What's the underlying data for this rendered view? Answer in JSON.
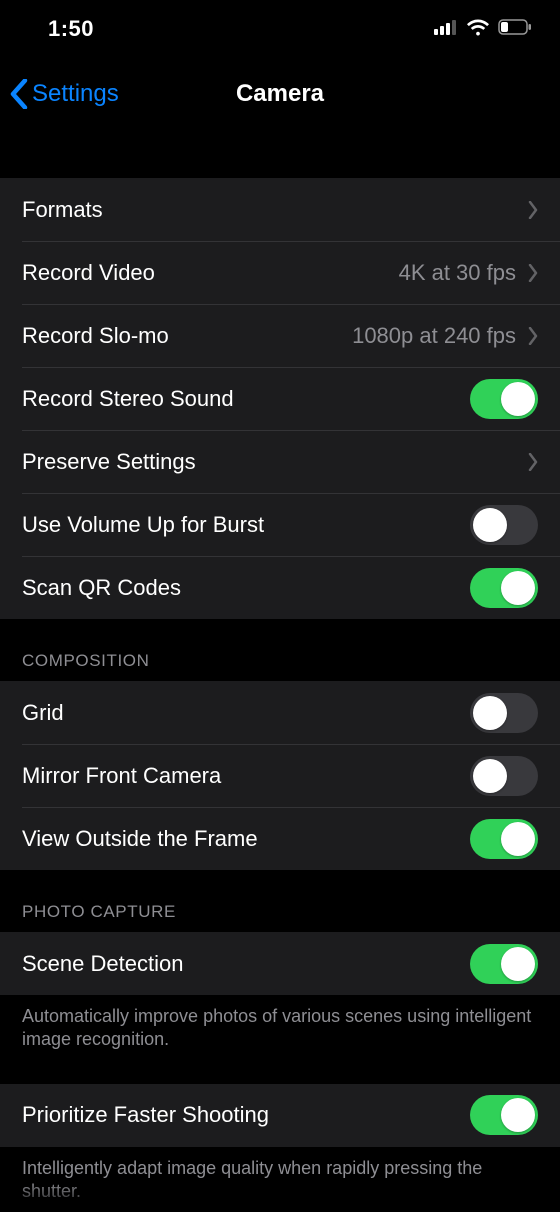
{
  "status": {
    "time": "1:50"
  },
  "nav": {
    "back": "Settings",
    "title": "Camera"
  },
  "group1": {
    "formats": "Formats",
    "record_video": {
      "label": "Record Video",
      "value": "4K at 30 fps"
    },
    "record_slomo": {
      "label": "Record Slo-mo",
      "value": "1080p at 240 fps"
    },
    "stereo": {
      "label": "Record Stereo Sound",
      "on": true
    },
    "preserve": "Preserve Settings",
    "volume_burst": {
      "label": "Use Volume Up for Burst",
      "on": false
    },
    "scan_qr": {
      "label": "Scan QR Codes",
      "on": true
    }
  },
  "composition": {
    "header": "Composition",
    "grid": {
      "label": "Grid",
      "on": false
    },
    "mirror": {
      "label": "Mirror Front Camera",
      "on": false
    },
    "view_outside": {
      "label": "View Outside the Frame",
      "on": true
    }
  },
  "photo_capture": {
    "header": "Photo Capture",
    "scene": {
      "label": "Scene Detection",
      "on": true
    },
    "scene_footer": "Automatically improve photos of various scenes using intelligent image recognition.",
    "faster": {
      "label": "Prioritize Faster Shooting",
      "on": true
    },
    "faster_footer": "Intelligently adapt image quality when rapidly pressing the shutter."
  },
  "colors": {
    "accent": "#0a84ff",
    "toggle_on": "#30d158"
  }
}
